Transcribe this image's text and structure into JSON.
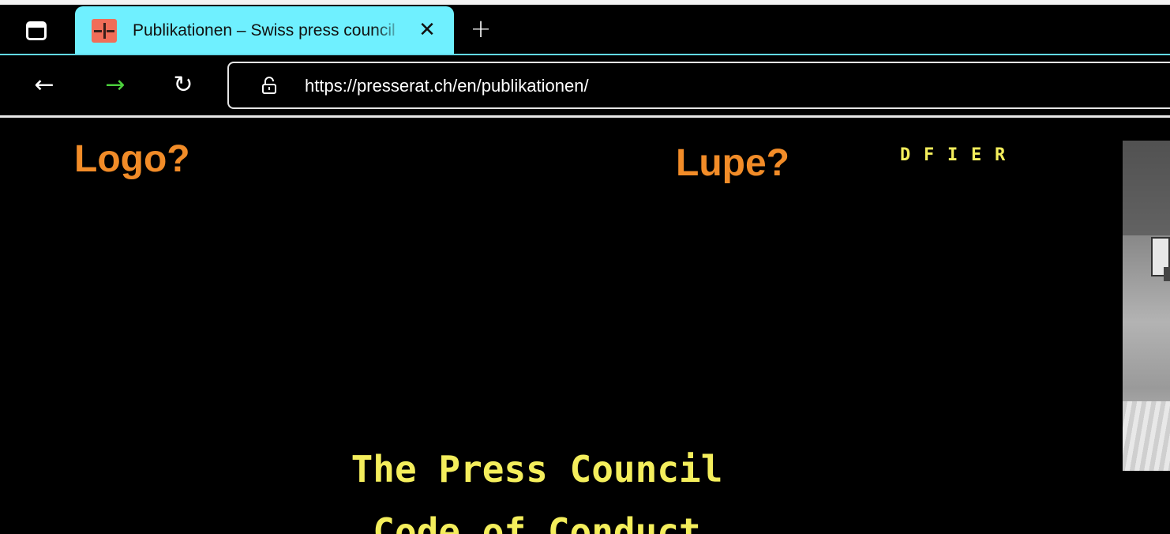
{
  "browser": {
    "tab": {
      "title": "Publikationen – Swiss press council",
      "close_glyph": "✕",
      "favicon_color": "#f06d58"
    },
    "new_tab_glyph": "+",
    "nav": {
      "back_glyph": "←",
      "forward_glyph": "→",
      "reload_glyph": "↻"
    },
    "address": {
      "url": "https://presserat.ch/en/publikationen/"
    },
    "accent_color": "#6ff0ff"
  },
  "annotations": {
    "logo": "Logo?",
    "search": "Lupe?",
    "color": "#f28c28"
  },
  "page": {
    "languages": [
      "D",
      "F",
      "I",
      "E",
      "R"
    ],
    "headings": [
      "The Press Council",
      "Code of Conduct"
    ],
    "text_color": "#f4ee5c"
  }
}
